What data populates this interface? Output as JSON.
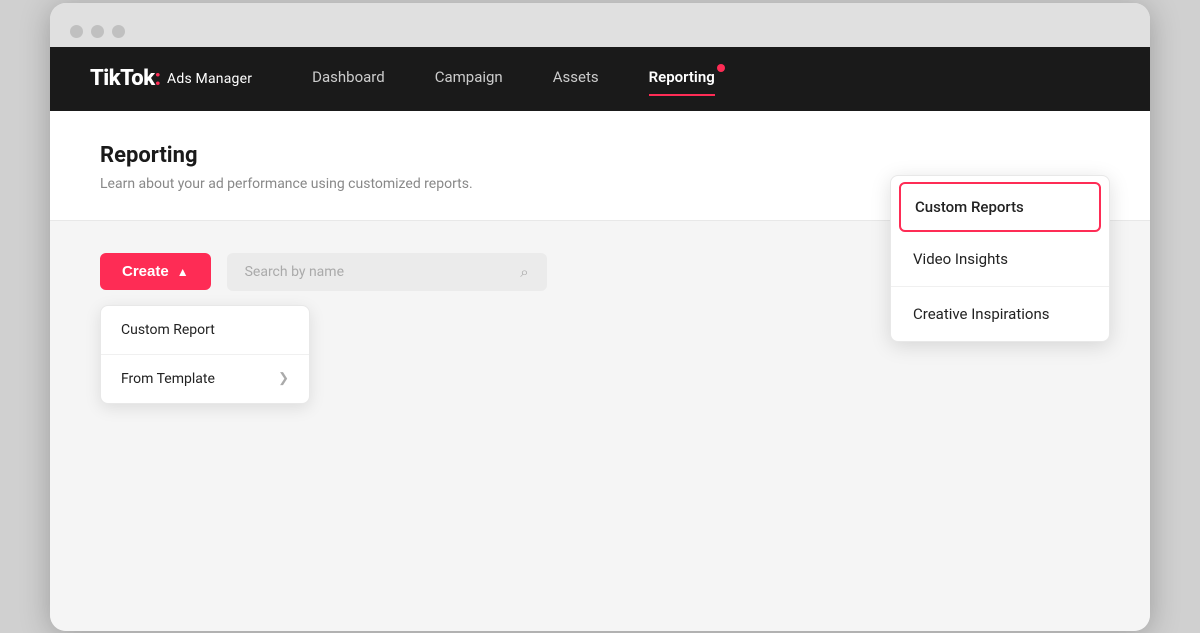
{
  "browser": {
    "dots": [
      "dot1",
      "dot2",
      "dot3"
    ]
  },
  "nav": {
    "logo_tiktok": "TikTok",
    "logo_colon": ":",
    "logo_ads": "Ads Manager",
    "items": [
      {
        "label": "Dashboard",
        "active": false
      },
      {
        "label": "Campaign",
        "active": false
      },
      {
        "label": "Assets",
        "active": false
      },
      {
        "label": "Reporting",
        "active": true
      }
    ]
  },
  "reporting_header": {
    "title": "Reporting",
    "subtitle": "Learn about your ad performance using customized reports."
  },
  "toolbar": {
    "create_label": "Create",
    "search_placeholder": "Search by name"
  },
  "create_dropdown": {
    "items": [
      {
        "label": "Custom Report",
        "has_arrow": false
      },
      {
        "label": "From Template",
        "has_arrow": true
      }
    ]
  },
  "reporting_dropdown": {
    "items": [
      {
        "label": "Custom Reports",
        "highlighted": true
      },
      {
        "label": "Video Insights",
        "highlighted": false
      },
      {
        "label": "Creative Inspirations",
        "highlighted": false
      }
    ]
  }
}
